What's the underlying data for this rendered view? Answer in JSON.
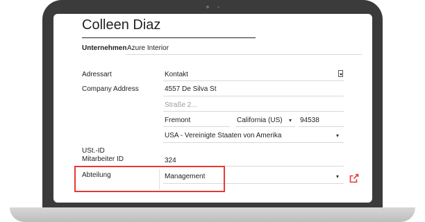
{
  "contact": {
    "name": "Colleen Diaz",
    "company_label": "Unternehmen",
    "company_value": "Azure Interior"
  },
  "address": {
    "type_label": "Adressart",
    "type_value": "Kontakt",
    "company_address_label": "Company Address",
    "street": "4557 De Silva St",
    "street2_placeholder": "Straße 2...",
    "city": "Fremont",
    "state": "California (US)",
    "zip": "94538",
    "country": "USA - Vereinigte Staaten von Amerika"
  },
  "fields": {
    "vat_label": "USt.-ID",
    "employee_id_label": "Mitarbeiter ID",
    "employee_id_value": "324",
    "department_label": "Abteilung",
    "department_value": "Management"
  },
  "icons": {
    "dropdown": "chevron-down-icon",
    "external": "external-link-icon",
    "accent": "#e53935"
  }
}
